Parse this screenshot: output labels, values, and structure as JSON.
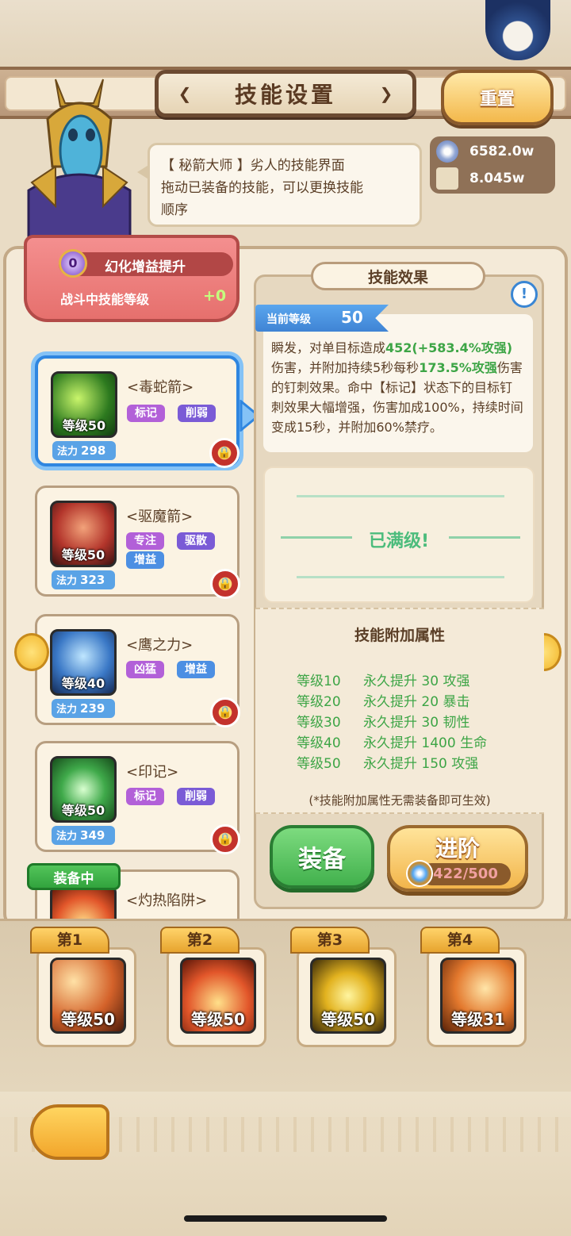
{
  "header": {
    "title": "技能设置",
    "reset_label": "重置"
  },
  "speech": {
    "line1": "【 秘箭大师 】劣人的技能界面",
    "line2": "拖动已装备的技能，可以更换技能",
    "line3": "顺序"
  },
  "currency": {
    "coins": "6582.0w",
    "scrolls": "8.045w"
  },
  "buff": {
    "badge": "0",
    "title": "幻化增益提升",
    "subtitle": "战斗中技能等级",
    "bonus": "+0"
  },
  "skills": [
    {
      "name": "<毒蛇箭>",
      "level_text": "等级50",
      "mana_label": "法力",
      "mana": "298",
      "tags": [
        "标记",
        "削弱"
      ]
    },
    {
      "name": "<驱魔箭>",
      "level_text": "等级50",
      "mana_label": "法力",
      "mana": "323",
      "tags": [
        "专注",
        "驱散",
        "增益"
      ]
    },
    {
      "name": "<鹰之力>",
      "level_text": "等级40",
      "mana_label": "法力",
      "mana": "239",
      "tags": [
        "凶猛",
        "增益"
      ]
    },
    {
      "name": "<印记>",
      "level_text": "等级50",
      "mana_label": "法力",
      "mana": "349",
      "tags": [
        "标记",
        "削弱"
      ]
    },
    {
      "name": "<灼热陷阱>",
      "equipped_label": "装备中"
    }
  ],
  "effect": {
    "header": "技能效果",
    "info": "!",
    "level_label": "当前等级",
    "level_value": "50",
    "desc_parts": [
      "瞬发，对单目标造成",
      "452(+583.4%攻强)",
      "伤害，并附加持续5秒每秒",
      "173.5%攻强",
      "伤害的钉刺效果。命中【标记】状态下的目标钉刺效果大幅增强，伤害加成100%，持续时间变成15秒，并附加60%禁疗。"
    ],
    "maxed_text": "已满级!"
  },
  "attributes": {
    "title": "技能附加属性",
    "rows": [
      {
        "level": "等级10",
        "bonus": "永久提升 30 攻强"
      },
      {
        "level": "等级20",
        "bonus": "永久提升 20 暴击"
      },
      {
        "level": "等级30",
        "bonus": "永久提升 30 韧性"
      },
      {
        "level": "等级40",
        "bonus": "永久提升 1400 生命"
      },
      {
        "level": "等级50",
        "bonus": "永久提升 150 攻强"
      }
    ],
    "note": "(*技能附加属性无需装备即可生效)"
  },
  "actions": {
    "equip": "装备",
    "advance": "进阶",
    "advance_cost": "422/500"
  },
  "slots": [
    {
      "tab": "第1",
      "level": "等级50"
    },
    {
      "tab": "第2",
      "level": "等级50"
    },
    {
      "tab": "第3",
      "level": "等级50"
    },
    {
      "tab": "第4",
      "level": "等级31"
    }
  ],
  "colors": {
    "selected_border": "#2f86e0",
    "attribute_green": "#3da546",
    "equip_green": "#42b14d",
    "advance_gold": "#f2b54b"
  }
}
